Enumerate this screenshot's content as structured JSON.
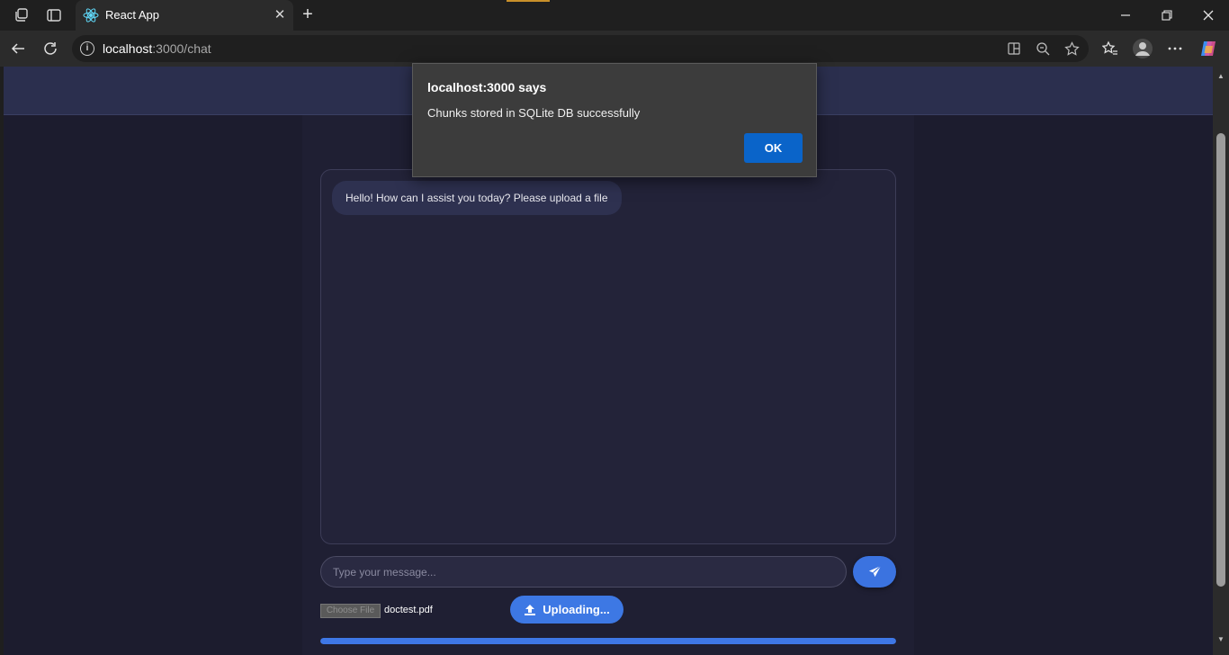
{
  "browser": {
    "tab_title": "React App",
    "url_host": "localhost",
    "url_path": ":3000/chat",
    "tab_close_glyph": "✕",
    "new_tab_glyph": "+"
  },
  "icons": {
    "workspaces": "workspaces-icon",
    "tab_actions": "tab-actions-icon",
    "favicon": "react-icon",
    "back": "back-arrow-icon",
    "refresh": "refresh-icon",
    "site_info": "info-icon",
    "split_screen": "split-screen-icon",
    "zoom": "zoom-out-icon",
    "favorite": "star-icon",
    "favorites": "favorites-icon",
    "profile": "profile-icon",
    "more": "more-icon",
    "copilot": "copilot-icon",
    "send": "paper-plane-icon",
    "upload": "upload-icon"
  },
  "colors": {
    "accent": "#3b73e0",
    "page_bg": "#1c1c2e",
    "header_bg": "#2b2f4e",
    "dialog_ok": "#0a64c9"
  },
  "chat": {
    "greeting": "Hello! How can I assist you today? Please upload a file",
    "input_placeholder": "Type your message...",
    "input_value": "",
    "choose_file_label": "Choose File",
    "file_name": "doctest.pdf",
    "upload_label": "Uploading...",
    "progress_fraction": 1.0
  },
  "dialog": {
    "title": "localhost:3000 says",
    "message": "Chunks stored in SQLite DB successfully",
    "ok_label": "OK"
  }
}
